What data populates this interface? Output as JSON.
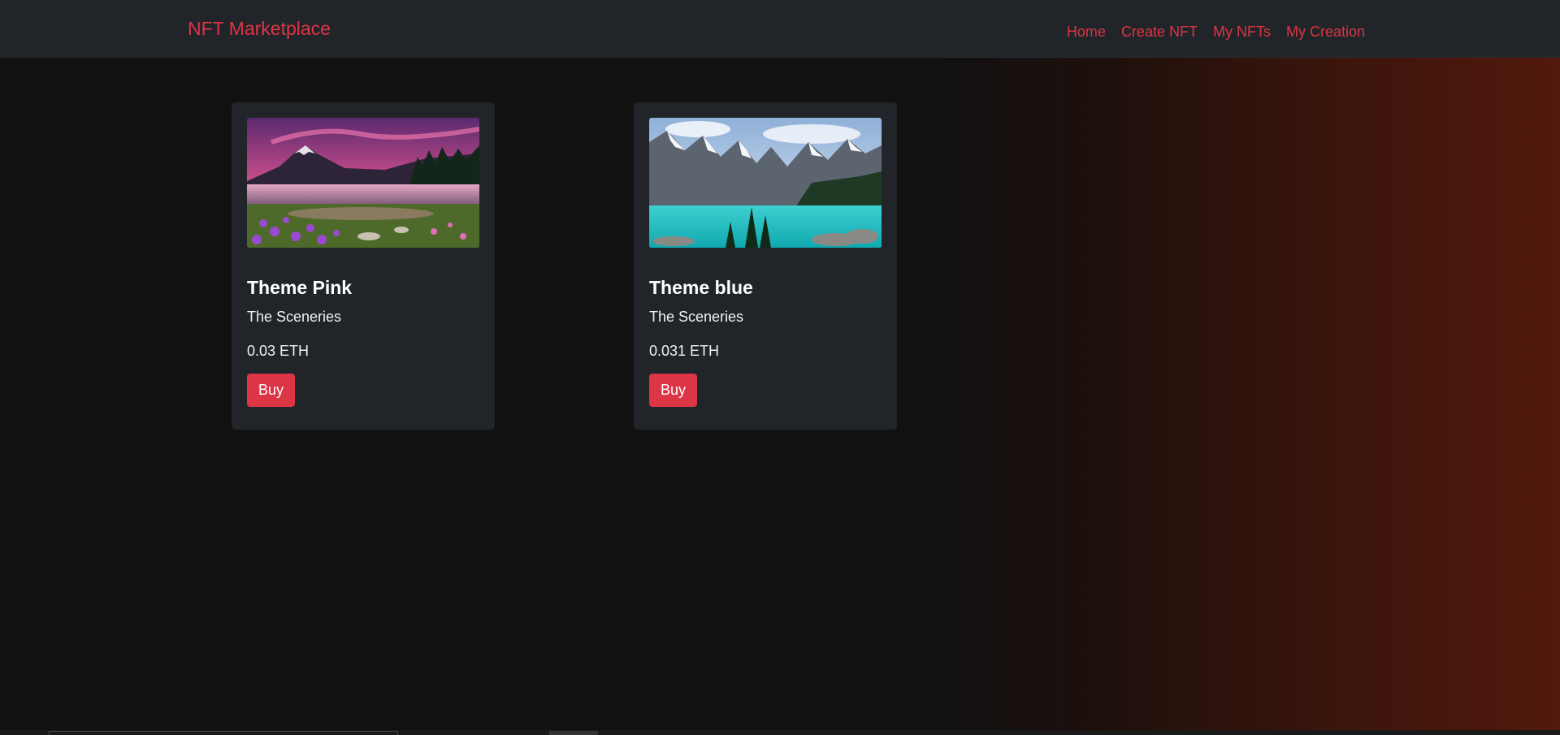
{
  "navbar": {
    "brand": "NFT Marketplace",
    "links": [
      "Home",
      "Create NFT",
      "My NFTs",
      "My Creation"
    ]
  },
  "cards": [
    {
      "image": "pink-lake-sunset-image",
      "title": "Theme Pink",
      "collection": "The Sceneries",
      "price": "0.03 ETH",
      "button": "Buy"
    },
    {
      "image": "turquoise-mountain-lake-image",
      "title": "Theme blue",
      "collection": "The Sceneries",
      "price": "0.031 ETH",
      "button": "Buy"
    }
  ],
  "colors": {
    "accent": "#dc3545",
    "navbar_bg": "#212529",
    "card_bg": "#212529",
    "page_bg": "#111111"
  }
}
